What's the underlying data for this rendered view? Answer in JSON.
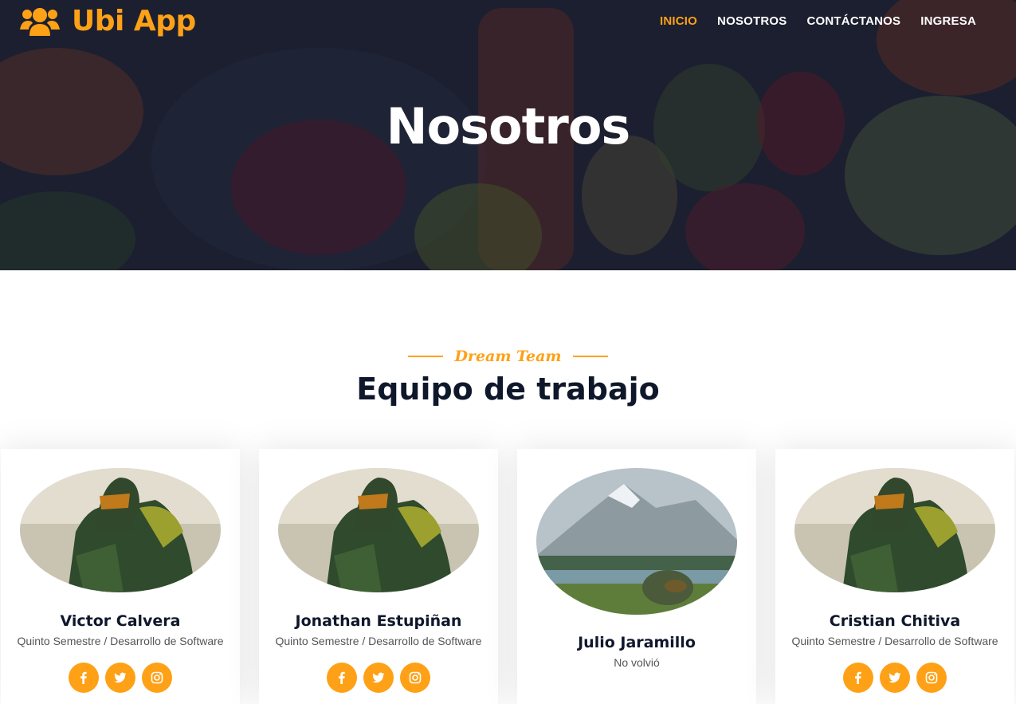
{
  "brand": {
    "name": "Ubi App",
    "icon": "users-icon",
    "color": "#fea116"
  },
  "nav": [
    {
      "label": "INICIO",
      "active": true
    },
    {
      "label": "NOSOTROS",
      "active": false
    },
    {
      "label": "CONTÁCTANOS",
      "active": false
    },
    {
      "label": "INGRESA",
      "active": false
    }
  ],
  "hero": {
    "title": "Nosotros"
  },
  "section": {
    "subtitle": "Dream Team",
    "title": "Equipo de trabajo"
  },
  "team": [
    {
      "name": "Victor Calvera",
      "role": "Quinto Semestre / Desarrollo de Software",
      "photo": "armored-soldier-photo"
    },
    {
      "name": "Jonathan Estupiñan",
      "role": "Quinto Semestre / Desarrollo de Software",
      "photo": "armored-soldier-photo"
    },
    {
      "name": "Julio Jaramillo",
      "role": "No volvió",
      "photo": "helmet-landscape-photo"
    },
    {
      "name": "Cristian Chitiva",
      "role": "Quinto Semestre / Desarrollo de Software",
      "photo": "armored-soldier-photo"
    }
  ],
  "social_icons": [
    "facebook-icon",
    "twitter-icon",
    "instagram-icon"
  ]
}
